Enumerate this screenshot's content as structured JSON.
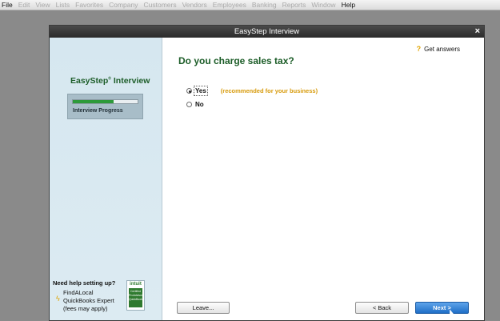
{
  "menubar": {
    "items": [
      {
        "label": "File",
        "active": true
      },
      {
        "label": "Edit",
        "active": false
      },
      {
        "label": "View",
        "active": false
      },
      {
        "label": "Lists",
        "active": false
      },
      {
        "label": "Favorites",
        "active": false
      },
      {
        "label": "Company",
        "active": false
      },
      {
        "label": "Customers",
        "active": false
      },
      {
        "label": "Vendors",
        "active": false
      },
      {
        "label": "Employees",
        "active": false
      },
      {
        "label": "Banking",
        "active": false
      },
      {
        "label": "Reports",
        "active": false
      },
      {
        "label": "Window",
        "active": false
      },
      {
        "label": "Help",
        "active": true
      }
    ]
  },
  "dialog": {
    "title": "EasyStep Interview",
    "close_label": "×"
  },
  "sidebar": {
    "brand": "EasyStep",
    "brand_mark": "®",
    "brand_suffix": "Interview",
    "progress_label": "Interview Progress",
    "progress_fraction": 0.63,
    "help_title": "Need help setting up?",
    "help_link_line1": "FindALocal",
    "help_link_line2": "QuickBooks Expert",
    "help_note": "(fees may apply)",
    "badge_brand": "intuit",
    "badge_text": "Certified ProAdvisor QuickBooks"
  },
  "main": {
    "get_answers": "Get answers",
    "question": "Do you charge sales tax?",
    "options": [
      {
        "label": "Yes",
        "selected": true,
        "note": "(recommended for your business)"
      },
      {
        "label": "No",
        "selected": false,
        "note": ""
      }
    ],
    "buttons": {
      "leave": "Leave...",
      "back": "< Back",
      "next": "Next >"
    }
  },
  "colors": {
    "accent_green": "#1c5d28",
    "recommend_orange": "#d79a0a",
    "primary_blue": "#1f6fc7"
  }
}
